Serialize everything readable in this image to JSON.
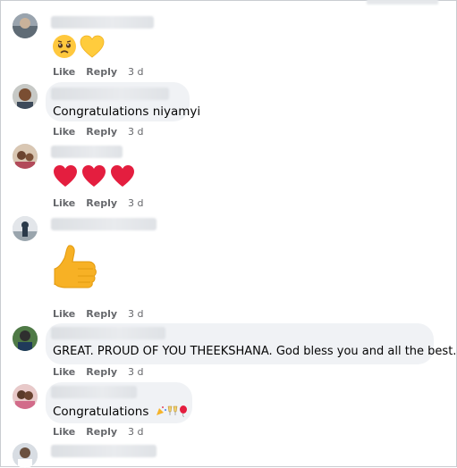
{
  "colors": {
    "bubble": "#f0f2f5",
    "action_text": "#65676b",
    "body_text": "#050505",
    "heart_red": "#e41e3f",
    "thumb_yellow": "#f7b125",
    "heart_yellow": "#ffcc3d"
  },
  "actions": {
    "like_label": "Like",
    "reply_label": "Reply"
  },
  "comments": [
    {
      "kind": "emoji",
      "emojis": [
        "crying-face-icon",
        "yellow-heart-icon"
      ],
      "time": "3 d"
    },
    {
      "kind": "text",
      "text": "Congratulations niyamyi",
      "time": "3 d"
    },
    {
      "kind": "emoji",
      "emojis": [
        "red-heart-icon",
        "red-heart-icon",
        "red-heart-icon"
      ],
      "time": "3 d"
    },
    {
      "kind": "emoji",
      "emojis": [
        "thumbs-up-icon"
      ],
      "time": "3 d"
    },
    {
      "kind": "text",
      "text": "GREAT. PROUD OF YOU THEEKSHANA. God bless you and all the best.",
      "time": "3 d"
    },
    {
      "kind": "text",
      "text": "Congratulations",
      "emojis": [
        "party-popper-icon",
        "clinking-glasses-icon",
        "balloon-icon"
      ],
      "time": "3 d"
    },
    {
      "kind": "partial"
    }
  ]
}
